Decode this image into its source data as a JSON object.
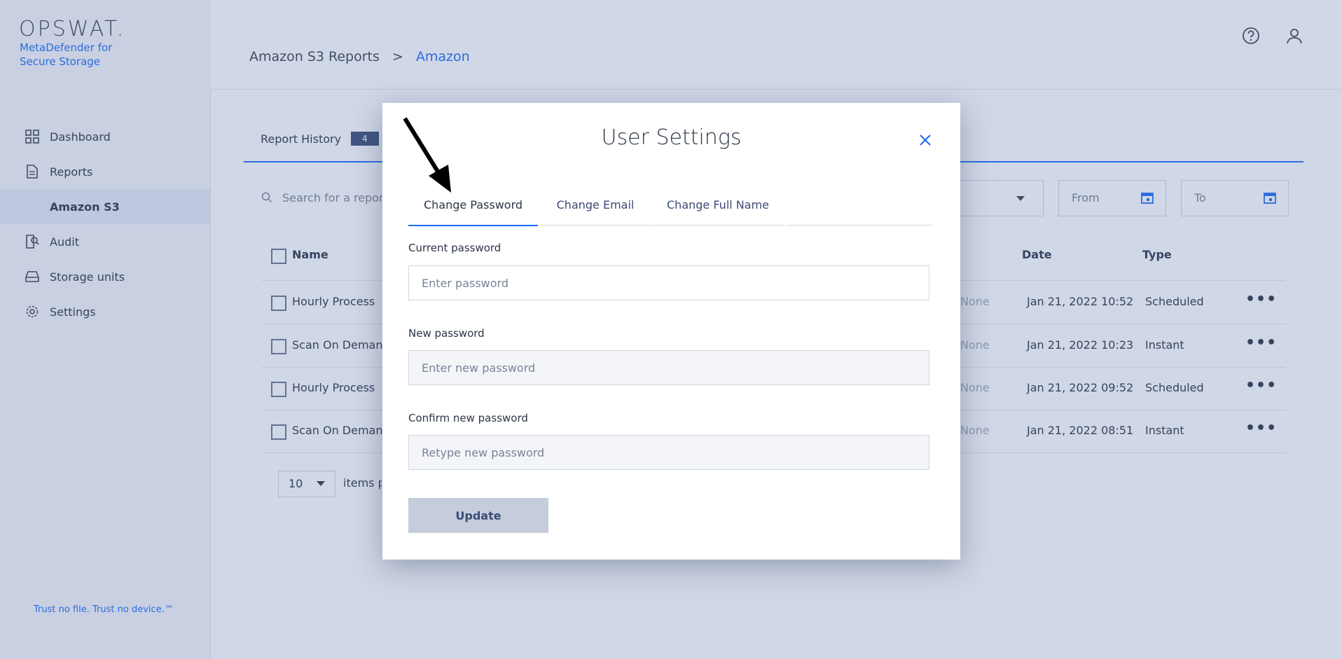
{
  "brand": {
    "logo": "OPSWAT.",
    "product": "MetaDefender for Secure Storage",
    "tagline": "Trust no file. Trust no device.™"
  },
  "sidebar": {
    "items": [
      {
        "label": "Dashboard",
        "icon": "grid-icon"
      },
      {
        "label": "Reports",
        "icon": "document-icon"
      },
      {
        "label": "Amazon S3",
        "icon": ""
      },
      {
        "label": "Audit",
        "icon": "audit-icon"
      },
      {
        "label": "Storage units",
        "icon": "storage-icon"
      },
      {
        "label": "Settings",
        "icon": "gear-icon"
      }
    ]
  },
  "header": {
    "breadcrumb": [
      "Amazon S3 Reports",
      "Amazon"
    ],
    "separator": ">",
    "icons": [
      "help-icon",
      "user-icon"
    ]
  },
  "main": {
    "tab_label": "Report History",
    "tab_badge": "4",
    "search_placeholder": "Search for a report",
    "date_from": "From",
    "date_to": "To",
    "columns": {
      "name": "Name",
      "date": "Date",
      "type": "Type"
    },
    "rows": [
      {
        "name": "Hourly Process",
        "status": "None",
        "date": "Jan 21, 2022 10:52",
        "type": "Scheduled"
      },
      {
        "name": "Scan On Demand",
        "status": "None",
        "date": "Jan 21, 2022 10:23",
        "type": "Instant"
      },
      {
        "name": "Hourly Process",
        "status": "None",
        "date": "Jan 21, 2022 09:52",
        "type": "Scheduled"
      },
      {
        "name": "Scan On Demand",
        "status": "None",
        "date": "Jan 21, 2022 08:51",
        "type": "Instant"
      }
    ],
    "per_page_value": "10",
    "per_page_label": "items pe"
  },
  "modal": {
    "title": "User Settings",
    "tabs": [
      "Change Password",
      "Change Email",
      "Change Full Name"
    ],
    "active_tab": "Change Password",
    "fields": [
      {
        "label": "Current password",
        "placeholder": "Enter password"
      },
      {
        "label": "New password",
        "placeholder": "Enter new password"
      },
      {
        "label": "Confirm new password",
        "placeholder": "Retype new password"
      }
    ],
    "submit_label": "Update"
  },
  "colors": {
    "accent": "#1d6bf3",
    "overlay": "#5670a6",
    "badge": "#3b4b73",
    "button_disabled": "#c5ccdb"
  }
}
